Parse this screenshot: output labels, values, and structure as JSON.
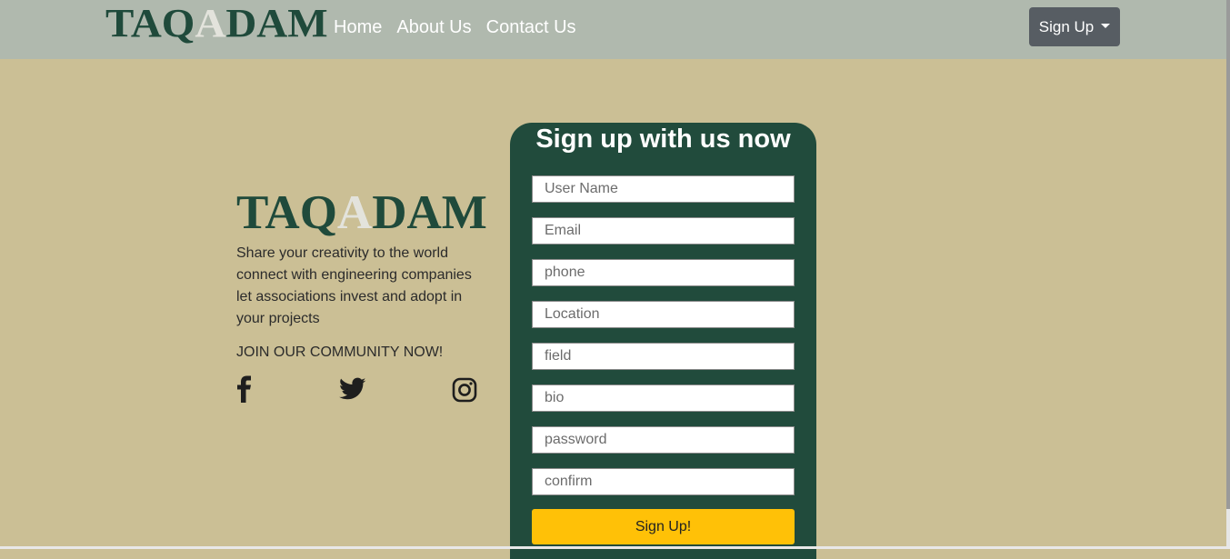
{
  "nav": {
    "logo": {
      "part1": "TAQ",
      "highlight": "A",
      "part2": "DAM"
    },
    "links": [
      "Home",
      "About Us",
      "Contact Us"
    ],
    "signup_label": "Sign Up"
  },
  "intro": {
    "logo": {
      "part1": "TAQ",
      "highlight": "A",
      "part2": "DAM"
    },
    "lines": [
      "Share your creativity to the world",
      "connect with engineering companies",
      "let associations invest and adopt in",
      "your projects"
    ],
    "join": "JOIN OUR COMMUNITY NOW!",
    "social_icons": [
      "facebook-icon",
      "twitter-icon",
      "instagram-icon"
    ]
  },
  "form": {
    "title": "Sign up with us now",
    "fields": [
      {
        "placeholder": "User Name",
        "value": ""
      },
      {
        "placeholder": "Email",
        "value": ""
      },
      {
        "placeholder": "phone",
        "value": ""
      },
      {
        "placeholder": "Location",
        "value": ""
      },
      {
        "placeholder": "field",
        "value": ""
      },
      {
        "placeholder": "bio",
        "value": ""
      },
      {
        "placeholder": "password",
        "value": ""
      },
      {
        "placeholder": "confirm",
        "value": ""
      }
    ],
    "submit_label": "Sign Up!"
  },
  "colors": {
    "page_bg": "#cbbf95",
    "navbar_bg": "#b0b9ae",
    "brand_green": "#214b3c",
    "accent_yellow": "#ffc107",
    "button_gray": "#575d63"
  }
}
